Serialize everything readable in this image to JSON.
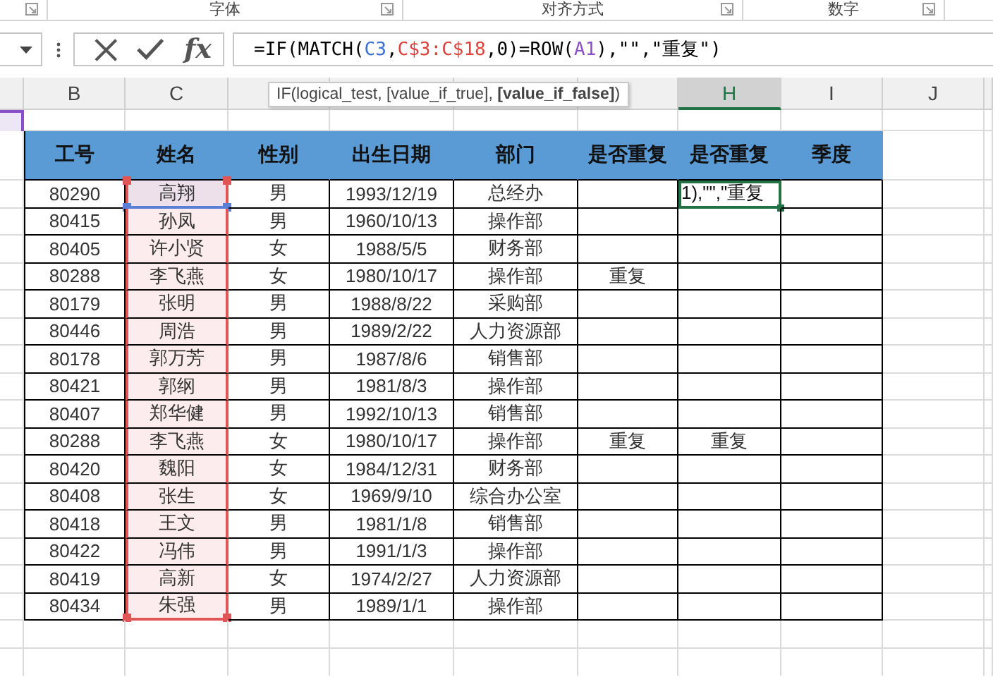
{
  "ribbon": {
    "groups": [
      "字体",
      "对齐方式",
      "数字"
    ]
  },
  "formula_bar": {
    "function_button": "fx",
    "formula": [
      {
        "text": "=IF(MATCH(",
        "color": "#000000"
      },
      {
        "text": "C3",
        "color": "#3a6fd8"
      },
      {
        "text": ",",
        "color": "#000000"
      },
      {
        "text": "C$3:C$18",
        "color": "#e0403a"
      },
      {
        "text": ",0)=ROW(",
        "color": "#000000"
      },
      {
        "text": "A1",
        "color": "#8a4fc8"
      },
      {
        "text": "),\"\",\"重复\")",
        "color": "#000000"
      }
    ]
  },
  "tooltip": "IF(logical_test, [value_if_true], **[value_if_false]**)",
  "sheet_columns": [
    {
      "label": "B",
      "selected": false
    },
    {
      "label": "C",
      "selected": false
    },
    {
      "selected": false
    },
    {
      "selected": false
    },
    {
      "selected": false
    },
    {
      "selected": false
    },
    {
      "label": "H",
      "selected": true
    },
    {
      "label": "I",
      "selected": false
    },
    {
      "label": "J",
      "selected": false
    }
  ],
  "table": {
    "columns": [
      {
        "label": "工号",
        "referenced": false
      },
      {
        "label": "姓名",
        "referenced": true
      },
      {
        "label": "性别",
        "referenced": false
      },
      {
        "label": "出生日期",
        "referenced": false
      },
      {
        "label": "部门",
        "referenced": false
      },
      {
        "label": "是否重复",
        "referenced": false
      },
      {
        "label": "是否重复",
        "referenced": false
      },
      {
        "label": "季度",
        "referenced": false
      }
    ],
    "rows": [
      {
        "active": true,
        "cells": [
          "80290",
          "高翔",
          "男",
          "1993/12/19",
          "总经办",
          "",
          "1),\"\",\"重复",
          ""
        ]
      },
      {
        "active": false,
        "cells": [
          "80415",
          "孙凤",
          "男",
          "1960/10/13",
          "操作部",
          "",
          "",
          ""
        ]
      },
      {
        "active": false,
        "cells": [
          "80405",
          "许小贤",
          "女",
          "1988/5/5",
          "财务部",
          "",
          "",
          ""
        ]
      },
      {
        "active": false,
        "cells": [
          "80288",
          "李飞燕",
          "女",
          "1980/10/17",
          "操作部",
          "重复",
          "",
          ""
        ]
      },
      {
        "active": false,
        "cells": [
          "80179",
          "张明",
          "男",
          "1988/8/22",
          "采购部",
          "",
          "",
          ""
        ]
      },
      {
        "active": false,
        "cells": [
          "80446",
          "周浩",
          "男",
          "1989/2/22",
          "人力资源部",
          "",
          "",
          ""
        ]
      },
      {
        "active": false,
        "cells": [
          "80178",
          "郭万芳",
          "男",
          "1987/8/6",
          "销售部",
          "",
          "",
          ""
        ]
      },
      {
        "active": false,
        "cells": [
          "80421",
          "郭纲",
          "男",
          "1981/8/3",
          "操作部",
          "",
          "",
          ""
        ]
      },
      {
        "active": false,
        "cells": [
          "80407",
          "郑华健",
          "男",
          "1992/10/13",
          "销售部",
          "",
          "",
          ""
        ]
      },
      {
        "active": false,
        "cells": [
          "80288",
          "李飞燕",
          "女",
          "1980/10/17",
          "操作部",
          "重复",
          "重复",
          ""
        ]
      },
      {
        "active": false,
        "cells": [
          "80420",
          "魏阳",
          "女",
          "1984/12/31",
          "财务部",
          "",
          "",
          ""
        ]
      },
      {
        "active": false,
        "cells": [
          "80408",
          "张生",
          "女",
          "1969/9/10",
          "综合办公室",
          "",
          "",
          ""
        ]
      },
      {
        "active": false,
        "cells": [
          "80418",
          "王文",
          "男",
          "1981/1/8",
          "销售部",
          "",
          "",
          ""
        ]
      },
      {
        "active": false,
        "cells": [
          "80422",
          "冯伟",
          "男",
          "1991/1/3",
          "操作部",
          "",
          "",
          ""
        ]
      },
      {
        "active": false,
        "cells": [
          "80419",
          "高新",
          "女",
          "1974/2/27",
          "人力资源部",
          "",
          "",
          ""
        ]
      },
      {
        "active": false,
        "cells": [
          "80434",
          "朱强",
          "男",
          "1989/1/1",
          "操作部",
          "",
          "",
          ""
        ]
      }
    ]
  }
}
